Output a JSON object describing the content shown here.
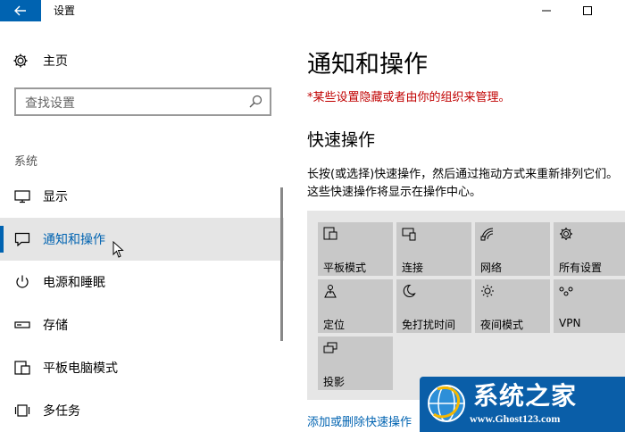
{
  "window": {
    "title": "设置"
  },
  "sidebar": {
    "home_label": "主页",
    "search_placeholder": "查找设置",
    "section_label": "系统",
    "items": [
      {
        "label": "显示",
        "icon": "monitor-icon"
      },
      {
        "label": "通知和操作",
        "icon": "notification-icon",
        "active": true
      },
      {
        "label": "电源和睡眠",
        "icon": "power-icon"
      },
      {
        "label": "存储",
        "icon": "storage-icon"
      },
      {
        "label": "平板电脑模式",
        "icon": "tablet-icon"
      },
      {
        "label": "多任务",
        "icon": "multitask-icon"
      }
    ]
  },
  "main": {
    "title": "通知和操作",
    "warning": "*某些设置隐藏或者由你的组织来管理。",
    "quick_actions_title": "快速操作",
    "description": "长按(或选择)快速操作，然后通过拖动方式来重新排列它们。这些快速操作将显示在操作中心。",
    "tiles": [
      {
        "label": "平板模式",
        "icon": "tablet-mode-icon"
      },
      {
        "label": "连接",
        "icon": "connect-icon"
      },
      {
        "label": "网络",
        "icon": "network-icon"
      },
      {
        "label": "所有设置",
        "icon": "gear-icon"
      },
      {
        "label": "定位",
        "icon": "location-icon"
      },
      {
        "label": "免打扰时间",
        "icon": "moon-icon"
      },
      {
        "label": "夜间模式",
        "icon": "sun-icon"
      },
      {
        "label": "VPN",
        "icon": "vpn-icon"
      },
      {
        "label": "投影",
        "icon": "project-icon"
      }
    ],
    "link": "添加或删除快速操作"
  },
  "watermark": {
    "title": "系统之家",
    "url": "www.Ghost123.com"
  },
  "colors": {
    "accent": "#0063b1",
    "warning": "#c00000",
    "tile": "#c8c8c8",
    "tile_panel": "#e6e6e6"
  }
}
